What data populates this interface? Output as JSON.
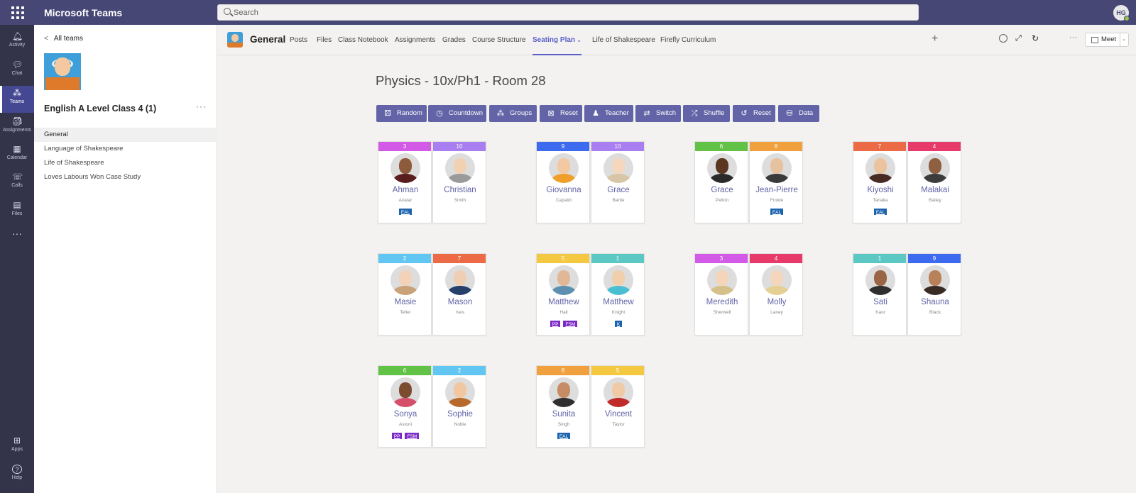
{
  "app": {
    "name": "Microsoft Teams",
    "search_placeholder": "Search",
    "user_initials": "HG"
  },
  "rail": [
    {
      "label": "Activity",
      "icon": "bell-icon",
      "active": false
    },
    {
      "label": "Chat",
      "icon": "chat-icon",
      "active": false
    },
    {
      "label": "Teams",
      "icon": "teams-icon",
      "active": true
    },
    {
      "label": "Assignments",
      "icon": "assignments-icon",
      "active": false
    },
    {
      "label": "Calendar",
      "icon": "calendar-icon",
      "active": false
    },
    {
      "label": "Calls",
      "icon": "phone-icon",
      "active": false
    },
    {
      "label": "Files",
      "icon": "file-icon",
      "active": false
    },
    {
      "label": "Apps",
      "icon": "apps-icon",
      "active": false
    },
    {
      "label": "Help",
      "icon": "help-icon",
      "active": false
    }
  ],
  "team": {
    "back_label": "All teams",
    "name": "English A Level Class 4 (1)",
    "more": "···",
    "channels": [
      "General",
      "Language of Shakespeare",
      "Life of Shakespeare",
      "Loves Labours Won Case Study"
    ]
  },
  "header": {
    "channel": "General",
    "tabs": [
      "Posts",
      "Files",
      "Class Notebook",
      "Assignments",
      "Grades",
      "Course Structure",
      "Seating Plan",
      "Life of Shakespeare",
      "Firefly Curriculum"
    ],
    "active_tab": "Seating Plan",
    "meet_label": "Meet"
  },
  "plan": {
    "title": "Physics - 10x/Ph1 - Room 28",
    "toolbar": [
      {
        "label": "Random",
        "icon": "dice-icon"
      },
      {
        "label": "Countdown",
        "icon": "timer-icon"
      },
      {
        "label": "Groups",
        "icon": "groups-icon"
      },
      {
        "label": "Reset",
        "icon": "reset-grid-icon"
      },
      {
        "label": "Teacher",
        "icon": "teacher-icon"
      },
      {
        "label": "Switch",
        "icon": "switch-icon"
      },
      {
        "label": "Shuffle",
        "icon": "shuffle-icon"
      },
      {
        "label": "Reset",
        "icon": "undo-icon"
      },
      {
        "label": "Data",
        "icon": "data-icon"
      }
    ],
    "group_colors": {
      "1": "#5bc8c4",
      "2": "#62c6f2",
      "3": "#d25ae6",
      "4": "#e83a6a",
      "5": "#f5c842",
      "6": "#61c245",
      "7": "#ec6a45",
      "8": "#f0a03c",
      "9": "#3d6bf0",
      "10": "#a87ef0"
    },
    "students": [
      {
        "group": "3",
        "first": "Ahman",
        "last": "Avatar",
        "tags": [
          "EAL"
        ],
        "skin": "#8d5a3c",
        "shirt": "#5a1d1d"
      },
      {
        "group": "10",
        "first": "Christian",
        "last": "Smith",
        "tags": [],
        "skin": "#f2d1b3",
        "shirt": "#9a9a9a"
      },
      {
        "group": "9",
        "first": "Giovanna",
        "last": "Capaldi",
        "tags": [],
        "skin": "#f3c9a3",
        "shirt": "#f0a02a"
      },
      {
        "group": "10",
        "first": "Grace",
        "last": "Bartle",
        "tags": [],
        "skin": "#f4d7bd",
        "shirt": "#d7c5a5"
      },
      {
        "group": "6",
        "first": "Grace",
        "last": "Pelton",
        "tags": [],
        "skin": "#5b3621",
        "shirt": "#2a2a2a"
      },
      {
        "group": "8",
        "first": "Jean-Pierre",
        "last": "Froide",
        "tags": [
          "EAL"
        ],
        "skin": "#e7c2a0",
        "shirt": "#3a3a3a"
      },
      {
        "group": "7",
        "first": "Kiyoshi",
        "last": "Tanaka",
        "tags": [
          "EAL"
        ],
        "skin": "#ecc39f",
        "shirt": "#4a2a24"
      },
      {
        "group": "4",
        "first": "Malakai",
        "last": "Bailey",
        "tags": [],
        "skin": "#8e5f40",
        "shirt": "#3c3c3c"
      },
      {
        "group": "2",
        "first": "Masie",
        "last": "Teller",
        "tags": [],
        "skin": "#f2d2b8",
        "shirt": "#c9a27a"
      },
      {
        "group": "7",
        "first": "Mason",
        "last": "Ives",
        "tags": [],
        "skin": "#efcfb3",
        "shirt": "#24406b"
      },
      {
        "group": "5",
        "first": "Matthew",
        "last": "Hall",
        "tags": [
          "PP",
          "FSM"
        ],
        "skin": "#e1b897",
        "shirt": "#5c8fb0"
      },
      {
        "group": "1",
        "first": "Matthew",
        "last": "Knight",
        "tags": [
          "K"
        ],
        "skin": "#f1cfad",
        "shirt": "#4bbfd2"
      },
      {
        "group": "3",
        "first": "Meredith",
        "last": "Sherwell",
        "tags": [],
        "skin": "#f3d5ba",
        "shirt": "#d6c08a"
      },
      {
        "group": "4",
        "first": "Molly",
        "last": "Laney",
        "tags": [],
        "skin": "#f4d6bc",
        "shirt": "#e6cf92"
      },
      {
        "group": "1",
        "first": "Sati",
        "last": "Kaur",
        "tags": [],
        "skin": "#9a6545",
        "shirt": "#2f2f2f"
      },
      {
        "group": "9",
        "first": "Shauna",
        "last": "Black",
        "tags": [],
        "skin": "#b9815a",
        "shirt": "#3a2a24"
      },
      {
        "group": "6",
        "first": "Sonya",
        "last": "Astoni",
        "tags": [
          "PP",
          "FSM"
        ],
        "skin": "#7b4c30",
        "shirt": "#d54f6a"
      },
      {
        "group": "2",
        "first": "Sophie",
        "last": "Noble",
        "tags": [],
        "skin": "#f0c7a0",
        "shirt": "#b86a2c"
      },
      {
        "group": "8",
        "first": "Sunita",
        "last": "Singh",
        "tags": [
          "EAL"
        ],
        "skin": "#c68c66",
        "shirt": "#2f2f2f"
      },
      {
        "group": "5",
        "first": "Vincent",
        "last": "Taylor",
        "tags": [],
        "skin": "#f0c9a6",
        "shirt": "#c02a2a"
      }
    ]
  }
}
